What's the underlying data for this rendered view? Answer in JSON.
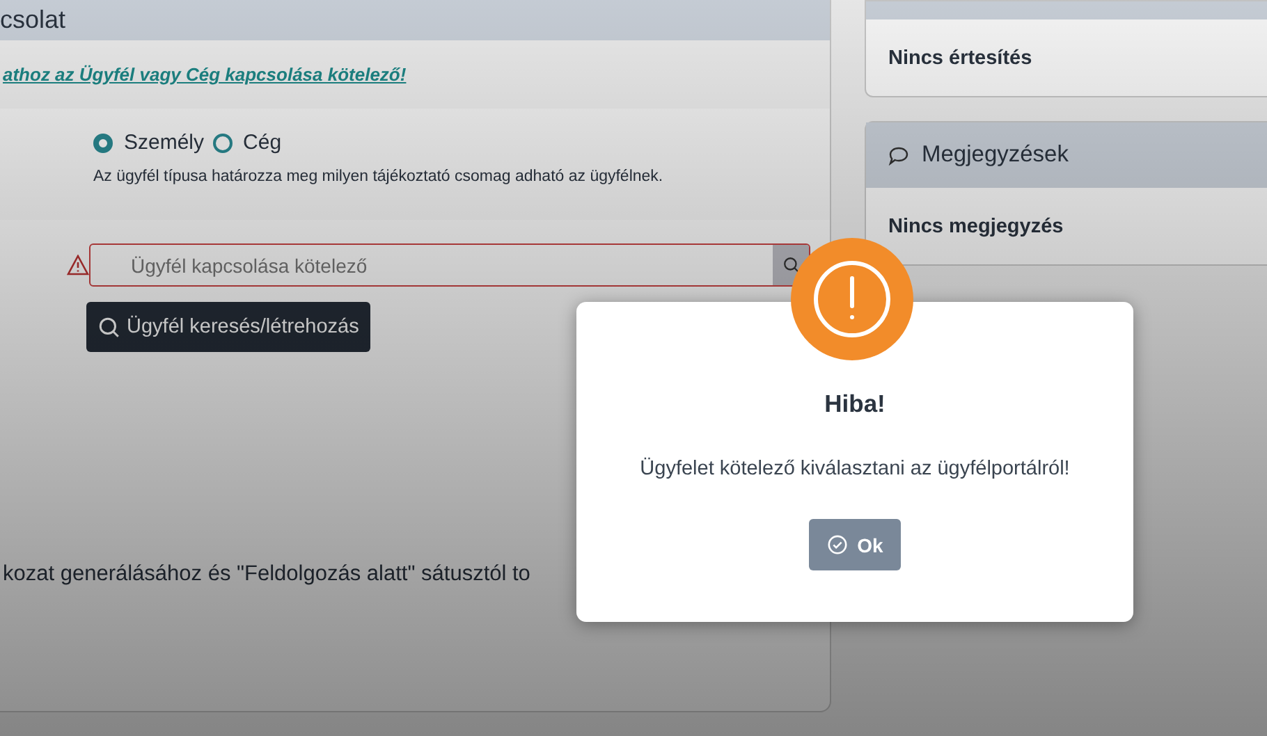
{
  "panel": {
    "title": "csolat",
    "notice_link": "athoz az Ügyfél vagy Cég kapcsolása kötelező!",
    "client_type": [
      {
        "label": "Személy",
        "selected": true
      },
      {
        "label": "Cég",
        "selected": false
      }
    ],
    "hint": "Az ügyfél típusa határozza meg milyen tájékoztató csomag adható az ügyfélnek.",
    "client_search": {
      "placeholder": "Ügyfél kapcsolása kötelező",
      "invalid": true
    },
    "search_button": "Ügyfél keresés/létrehozás",
    "note": "kozat generálásához és \"Feldolgozás alatt\" sátusztól to"
  },
  "notifications": {
    "empty_text": "Nincs értesítés"
  },
  "comments": {
    "title": "Megjegyzések",
    "empty_text": "Nincs megjegyzés"
  },
  "dialog": {
    "kind": "error",
    "title": "Hiba!",
    "message": "Ügyfelet kötelező kiválasztani az ügyfélportálról!",
    "button": "Ok"
  }
}
